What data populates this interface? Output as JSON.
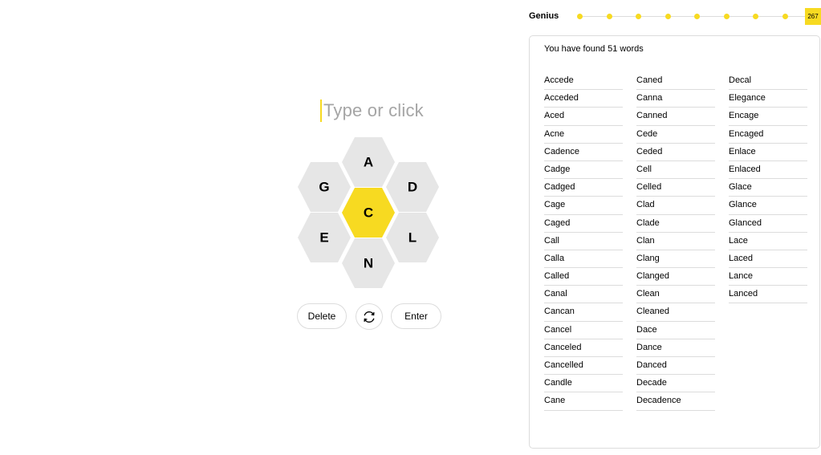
{
  "input": {
    "placeholder": "Type or click"
  },
  "hive": {
    "center_letter": "C",
    "outer_letters": {
      "top": "A",
      "upper_left": "G",
      "upper_right": "D",
      "lower_left": "E",
      "lower_right": "L",
      "bottom": "N"
    }
  },
  "controls": {
    "delete_label": "Delete",
    "shuffle_icon": "shuffle-icon",
    "enter_label": "Enter"
  },
  "progress": {
    "rank": "Genius",
    "score": "267",
    "levels_reached": 9,
    "total_levels": 9
  },
  "word_list": {
    "summary": "You have found 51 words",
    "columns": [
      [
        "Accede",
        "Acceded",
        "Aced",
        "Acne",
        "Cadence",
        "Cadge",
        "Cadged",
        "Cage",
        "Caged",
        "Call",
        "Calla",
        "Called",
        "Canal",
        "Cancan",
        "Cancel",
        "Canceled",
        "Cancelled",
        "Candle",
        "Cane"
      ],
      [
        "Caned",
        "Canna",
        "Canned",
        "Cede",
        "Ceded",
        "Cell",
        "Celled",
        "Clad",
        "Clade",
        "Clan",
        "Clang",
        "Clanged",
        "Clean",
        "Cleaned",
        "Dace",
        "Dance",
        "Danced",
        "Decade",
        "Decadence"
      ],
      [
        "Decal",
        "Elegance",
        "Encage",
        "Encaged",
        "Enlace",
        "Enlaced",
        "Glace",
        "Glance",
        "Glanced",
        "Lace",
        "Laced",
        "Lance",
        "Lanced"
      ]
    ]
  },
  "colors": {
    "accent": "#f7da21",
    "cell": "#e6e6e6",
    "border": "#dcdcdc",
    "placeholder": "#a5a5a5"
  }
}
